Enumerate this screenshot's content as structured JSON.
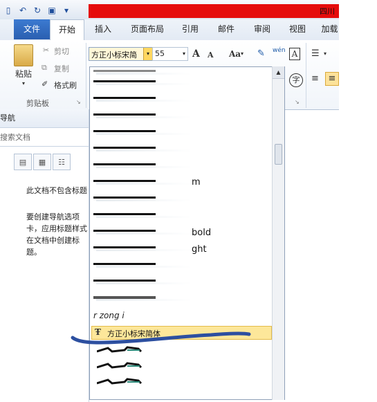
{
  "window": {
    "title": "四川"
  },
  "qat": {
    "undo": "↶",
    "redo": "↻",
    "save": "▣"
  },
  "tabs": [
    {
      "label": "文件"
    },
    {
      "label": "开始"
    },
    {
      "label": "插入"
    },
    {
      "label": "页面布局"
    },
    {
      "label": "引用"
    },
    {
      "label": "邮件"
    },
    {
      "label": "审阅"
    },
    {
      "label": "视图"
    },
    {
      "label": "加载"
    }
  ],
  "clipboard": {
    "paste": "粘贴",
    "cut": "剪切",
    "copy": "复制",
    "format_painter": "格式刷",
    "group_label": "剪贴板"
  },
  "font": {
    "name": "方正小标宋简",
    "size": "55",
    "grow": "A",
    "shrink": "A",
    "change_case": "Aa",
    "clear": "A",
    "phonetic": "wén",
    "border": "A"
  },
  "nav": {
    "title": "导航",
    "search_placeholder": "搜索文档",
    "msg1": "此文档不包含标题",
    "msg2": "要创建导航选项卡，应用标题样式在文档中创建标题。"
  },
  "dropdown": {
    "suffixes": [
      "m",
      "bold",
      "ght"
    ],
    "selected": "方正小标宋简体",
    "partial": "r zong i"
  }
}
